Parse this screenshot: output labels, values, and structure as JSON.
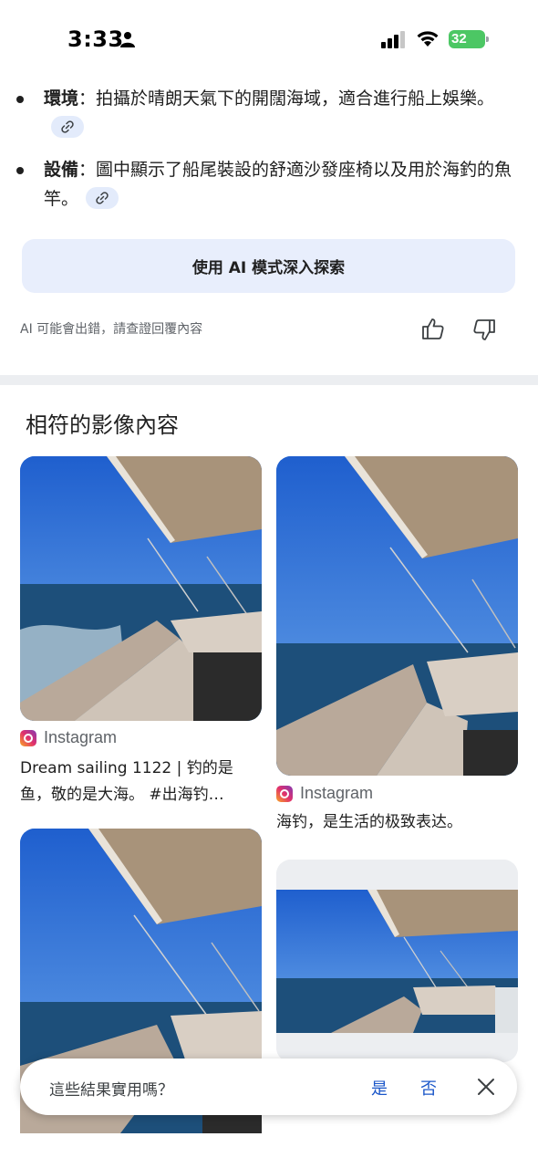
{
  "status_bar": {
    "time": "3:33",
    "battery": "32"
  },
  "bullets": [
    {
      "label": "環境",
      "text": "：拍攝於晴朗天氣下的開闊海域，適合進行船上娛樂。"
    },
    {
      "label": "設備",
      "text": "：圖中顯示了船尾裝設的舒適沙發座椅以及用於海釣的魚竿。"
    }
  ],
  "explore_button": "使用 AI 模式深入探索",
  "disclaimer": "AI 可能會出錯，請查證回覆內容",
  "section_title": "相符的影像內容",
  "cards": [
    {
      "source": "Instagram",
      "caption": "Dream sailing 1122 | 钓的是鱼，敬的是大海。 #出海钓…"
    },
    {
      "source": "Instagram",
      "caption": "海钓，是生活的极致表达。"
    }
  ],
  "feedback": {
    "question": "這些結果實用嗎？",
    "yes": "是",
    "no": "否"
  },
  "colors": {
    "accent_link": "#1a56c9",
    "explore_bg": "#e8eefc",
    "battery": "#4cc764"
  },
  "icons": [
    "person-icon",
    "signal-icon",
    "wifi-icon",
    "link-icon",
    "thumbs-up-icon",
    "thumbs-down-icon",
    "instagram-icon",
    "close-icon"
  ]
}
